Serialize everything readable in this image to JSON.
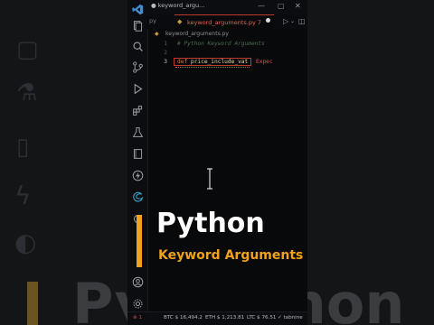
{
  "window": {
    "title_tab": "keyword_argu..."
  },
  "tabs": {
    "inactive": "py",
    "active": "keyword_arguments.py",
    "active_suffix": "7"
  },
  "breadcrumb": {
    "file": "keyword_arguments.py"
  },
  "editor": {
    "lines": [
      {
        "num": "1",
        "text": "# Python Keyword Arguments"
      },
      {
        "num": "2",
        "text": ""
      },
      {
        "num": "3",
        "keyword": "def",
        "name": "price_include_vat",
        "error_hint": "Expec"
      }
    ]
  },
  "caption": {
    "title": "Python",
    "subtitle": "Keyword Arguments"
  },
  "status": {
    "errors": "1",
    "btc": "BTC $ 16,494.2",
    "eth": "ETH $ 1,213.81",
    "ltc": "LTC $ 76.51",
    "tabnine": "tabnine"
  },
  "icons": [
    "vscode-logo-icon",
    "files-icon",
    "search-icon",
    "source-control-icon",
    "run-debug-icon",
    "extensions-icon",
    "flask-icon",
    "book-icon",
    "bolt-icon",
    "edge-icon",
    "account-icon",
    "gear-icon"
  ],
  "colors": {
    "accent": "#f0a21b",
    "error": "#e2504a",
    "tab_border": "#c0392b"
  }
}
